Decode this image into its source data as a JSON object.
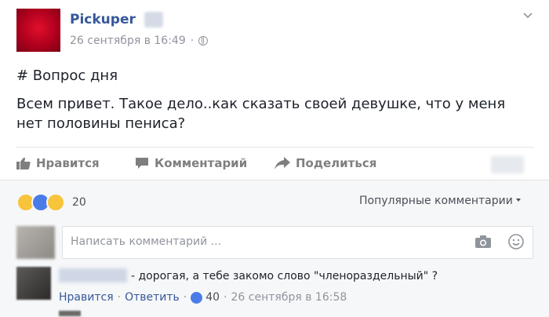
{
  "post": {
    "author": "Pickuper",
    "timestamp": "26 сентября в 16:49",
    "hashtag_line": "# Вопрос дня",
    "text": "Всем привет. Такое дело..как сказать своей девушке, что у меня нет половины пениса?"
  },
  "actions": {
    "like": "Нравится",
    "comment": "Комментарий",
    "share": "Поделиться"
  },
  "reactions": {
    "count": "20",
    "types": [
      "haha-icon",
      "like-icon",
      "wow-icon"
    ]
  },
  "comments_sort": "Популярные комментарии",
  "comment_box": {
    "placeholder": "Написать комментарий ..."
  },
  "comment": {
    "text": "- дорогая, а тебе закомо слово \"členoраздельный\" ?",
    "like_link": "Нравится",
    "reply_link": "Ответить",
    "like_count": "40",
    "timestamp": "26 сентября в 16:58",
    "separator": "·"
  },
  "colors": {
    "link": "#365899",
    "meta": "#90949c",
    "accent_blue": "#4a7ce8",
    "brand_red": "#c8001f"
  }
}
